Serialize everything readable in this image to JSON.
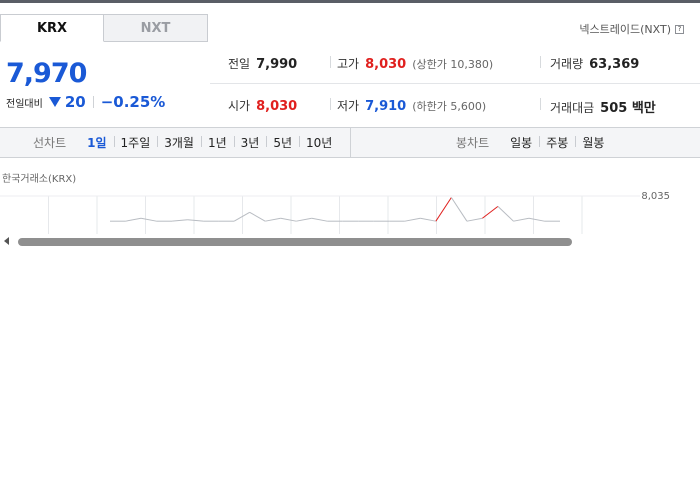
{
  "tabs": [
    {
      "label": "KRX",
      "active": true
    },
    {
      "label": "NXT",
      "active": false
    }
  ],
  "nxt_link": {
    "label": "넥스트레이드(NXT)",
    "help_glyph": "?"
  },
  "quote": {
    "price": "7,970",
    "change_label": "전일대비",
    "change_value": "20",
    "change_direction": "down",
    "change_percent": "−0.25%"
  },
  "stats": {
    "prev_close": {
      "label": "전일",
      "value": "7,990"
    },
    "high": {
      "label": "고가",
      "value": "8,030",
      "sub": "(상한가 10,380)"
    },
    "volume": {
      "label": "거래량",
      "value": "63,369"
    },
    "open": {
      "label": "시가",
      "value": "8,030"
    },
    "low": {
      "label": "저가",
      "value": "7,910",
      "sub": "(하한가 5,600)"
    },
    "amount": {
      "label": "거래대금",
      "value": "505 백만"
    }
  },
  "line_chart_tabs": {
    "title": "선차트",
    "items": [
      "1일",
      "1주일",
      "3개월",
      "1년",
      "3년",
      "5년",
      "10년"
    ],
    "active_index": 0
  },
  "candle_chart_tabs": {
    "title": "봉차트",
    "items": [
      "일봉",
      "주봉",
      "월봉"
    ]
  },
  "chart": {
    "caption": "한국거래소(KRX)",
    "max_label": "8,035"
  },
  "colors": {
    "up": "#e0201e",
    "down": "#1a59d6",
    "accent": "#1a59d6"
  },
  "chart_data": {
    "type": "line",
    "title": "",
    "xlabel": "",
    "ylabel": "",
    "ylim": [
      7900,
      8035
    ],
    "grid": true,
    "y_tick_labels": [
      "8,035"
    ],
    "series": [
      {
        "values": [
          7950,
          7950,
          7960,
          7950,
          7950,
          7955,
          7950,
          7950,
          7950,
          7980,
          7950,
          7960,
          7950,
          7960,
          7950,
          7950,
          7950,
          7950,
          7950,
          7950,
          7960,
          7950,
          8030,
          7950,
          7960,
          8000,
          7950,
          7960,
          7950,
          7950
        ]
      }
    ]
  }
}
